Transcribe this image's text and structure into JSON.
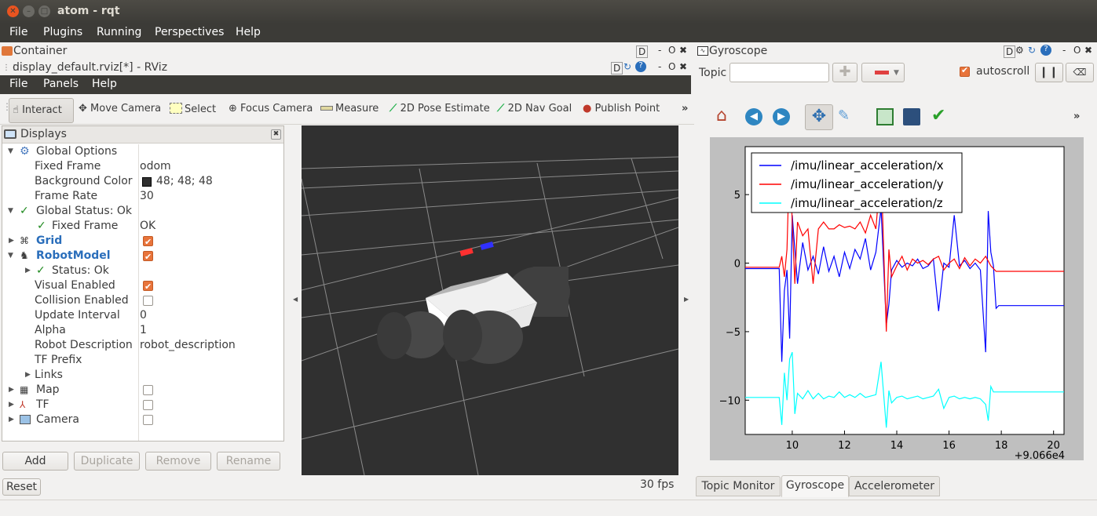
{
  "window": {
    "title": "atom - rqt"
  },
  "menubar": [
    "File",
    "Plugins",
    "Running",
    "Perspectives",
    "Help"
  ],
  "container": {
    "title": "Container",
    "icons": "D  - O ✖"
  },
  "rviz": {
    "title": "display_default.rviz[*] - RViz",
    "menus": [
      "File",
      "Panels",
      "Help"
    ],
    "tools": [
      "Interact",
      "Move Camera",
      "Select",
      "Focus Camera",
      "Measure",
      "2D Pose Estimate",
      "2D Nav Goal",
      "Publish Point"
    ],
    "more": "»",
    "fps": "30 fps"
  },
  "displays": {
    "title": "Displays",
    "rows": [
      {
        "label": "Global Options",
        "value": ""
      },
      {
        "label": "Fixed Frame",
        "value": "odom"
      },
      {
        "label": "Background Color",
        "value": "48; 48; 48"
      },
      {
        "label": "Frame Rate",
        "value": "30"
      },
      {
        "label": "Global Status: Ok",
        "value": ""
      },
      {
        "label": "Fixed Frame",
        "value": "OK"
      },
      {
        "label": "Grid",
        "value": ""
      },
      {
        "label": "RobotModel",
        "value": ""
      },
      {
        "label": "Status: Ok",
        "value": ""
      },
      {
        "label": "Visual Enabled",
        "value": ""
      },
      {
        "label": "Collision Enabled",
        "value": ""
      },
      {
        "label": "Update Interval",
        "value": "0"
      },
      {
        "label": "Alpha",
        "value": "1"
      },
      {
        "label": "Robot Description",
        "value": "robot_description"
      },
      {
        "label": "TF Prefix",
        "value": ""
      },
      {
        "label": "Links",
        "value": ""
      },
      {
        "label": "Map",
        "value": ""
      },
      {
        "label": "TF",
        "value": ""
      },
      {
        "label": "Camera",
        "value": ""
      }
    ],
    "buttons": {
      "add": "Add",
      "duplicate": "Duplicate",
      "remove": "Remove",
      "rename": "Rename"
    },
    "reset": "Reset"
  },
  "gyro": {
    "title": "Gyroscope",
    "topic_label": "Topic",
    "topic_value": "",
    "autoscroll": "autoscroll",
    "tabs": [
      "Topic Monitor",
      "Gyroscope",
      "Accelerometer"
    ],
    "offset_text": "+9.066e4"
  },
  "chart_data": {
    "type": "line",
    "xlim": [
      8.2,
      20.4
    ],
    "ylim": [
      -12.5,
      8.5
    ],
    "xticks": [
      10,
      12,
      14,
      16,
      18,
      20
    ],
    "yticks": [
      5,
      0,
      -5,
      -10
    ],
    "ytick_labels": [
      "5",
      "0",
      "−5",
      "−10"
    ],
    "legend_position": "top-left",
    "series": [
      {
        "name": "/imu/linear_acceleration/x",
        "color": "#0000ff",
        "x": [
          8.2,
          9.5,
          9.6,
          9.7,
          9.8,
          9.9,
          10.0,
          10.1,
          10.2,
          10.4,
          10.6,
          10.8,
          11.0,
          11.2,
          11.4,
          11.6,
          11.8,
          12.0,
          12.2,
          12.4,
          12.6,
          12.8,
          13.0,
          13.2,
          13.4,
          13.6,
          13.7,
          13.8,
          14.0,
          14.2,
          14.4,
          14.6,
          14.8,
          15.0,
          15.2,
          15.4,
          15.6,
          15.8,
          16.0,
          16.2,
          16.4,
          16.6,
          16.8,
          17.0,
          17.2,
          17.4,
          17.5,
          17.6,
          17.7,
          17.8,
          17.9,
          18.0,
          20.4
        ],
        "y": [
          -0.4,
          -0.4,
          -7.2,
          -2.0,
          -0.5,
          -5.5,
          3.5,
          1.0,
          -1.5,
          1.5,
          -0.5,
          0.5,
          -0.8,
          1.2,
          -0.6,
          0.5,
          -1.0,
          0.8,
          -0.4,
          1.0,
          0.3,
          1.8,
          -0.5,
          0.8,
          4.0,
          -4.5,
          -3.0,
          -0.5,
          0.2,
          -0.3,
          0.0,
          -0.2,
          0.3,
          -0.4,
          -0.2,
          0.3,
          -3.5,
          0.0,
          -0.3,
          3.5,
          -0.2,
          0.2,
          -0.4,
          0.0,
          -0.5,
          -6.5,
          3.8,
          0.8,
          -0.2,
          -3.3,
          -3.1,
          -3.1,
          -3.1
        ]
      },
      {
        "name": "/imu/linear_acceleration/y",
        "color": "#ff0000",
        "x": [
          8.2,
          9.5,
          9.6,
          9.7,
          9.8,
          9.9,
          10.0,
          10.1,
          10.2,
          10.4,
          10.6,
          10.8,
          11.0,
          11.2,
          11.4,
          11.6,
          11.8,
          12.0,
          12.2,
          12.4,
          12.6,
          12.8,
          13.0,
          13.2,
          13.4,
          13.6,
          13.7,
          13.8,
          14.0,
          14.2,
          14.4,
          14.6,
          14.8,
          15.0,
          15.2,
          15.4,
          15.6,
          15.8,
          16.0,
          16.2,
          16.4,
          16.6,
          16.8,
          17.0,
          17.2,
          17.4,
          17.6,
          17.8,
          20.4
        ],
        "y": [
          -0.3,
          -0.3,
          0.5,
          -1.0,
          1.0,
          8.0,
          3.0,
          -1.5,
          3.0,
          2.0,
          2.5,
          -1.5,
          2.5,
          3.0,
          2.5,
          2.5,
          2.8,
          2.6,
          2.7,
          2.5,
          3.0,
          2.2,
          3.5,
          2.5,
          7.0,
          -5.0,
          1.0,
          -1.0,
          -0.2,
          0.5,
          -0.5,
          0.3,
          0.0,
          0.2,
          -0.1,
          0.3,
          0.5,
          -0.5,
          0.0,
          0.3,
          -0.4,
          0.4,
          -0.2,
          0.3,
          0.0,
          0.5,
          -0.2,
          -0.6,
          -0.6
        ]
      },
      {
        "name": "/imu/linear_acceleration/z",
        "color": "#00ffff",
        "x": [
          8.2,
          9.5,
          9.6,
          9.7,
          9.8,
          9.9,
          10.0,
          10.1,
          10.2,
          10.4,
          10.6,
          10.8,
          11.0,
          11.2,
          11.4,
          11.6,
          11.8,
          12.0,
          12.2,
          12.4,
          12.6,
          12.8,
          13.0,
          13.2,
          13.4,
          13.6,
          13.7,
          13.8,
          14.0,
          14.2,
          14.4,
          14.6,
          14.8,
          15.0,
          15.2,
          15.4,
          15.6,
          15.8,
          16.0,
          16.2,
          16.4,
          16.6,
          16.8,
          17.0,
          17.2,
          17.4,
          17.5,
          17.6,
          17.7,
          17.8,
          20.4
        ],
        "y": [
          -9.8,
          -9.8,
          -11.8,
          -8.0,
          -10.0,
          -7.0,
          -6.5,
          -11.0,
          -9.5,
          -9.9,
          -9.3,
          -9.9,
          -9.5,
          -9.9,
          -9.7,
          -9.8,
          -9.4,
          -9.8,
          -9.6,
          -9.8,
          -9.5,
          -9.8,
          -9.7,
          -9.6,
          -7.2,
          -12.0,
          -9.3,
          -10.2,
          -9.8,
          -9.7,
          -9.9,
          -9.8,
          -9.7,
          -9.9,
          -9.8,
          -9.7,
          -9.2,
          -10.6,
          -9.8,
          -9.7,
          -9.9,
          -9.8,
          -9.9,
          -9.8,
          -9.9,
          -10.3,
          -11.5,
          -9.0,
          -9.4,
          -9.4,
          -9.4
        ]
      }
    ]
  }
}
